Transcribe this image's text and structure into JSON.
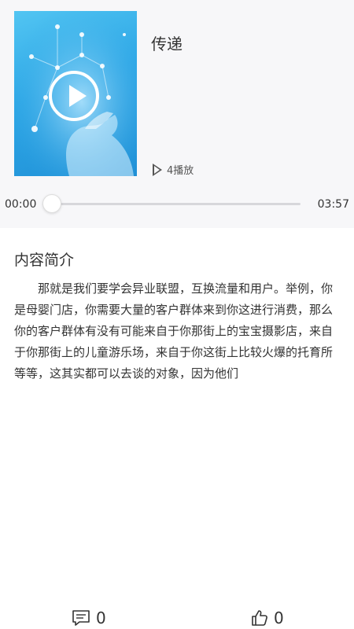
{
  "audio": {
    "title": "传递",
    "play_count_label": "4播放",
    "current_time": "00:00",
    "duration": "03:57",
    "progress_fraction": 0
  },
  "intro": {
    "heading": "内容简介",
    "body": "那就是我们要学会异业联盟，互换流量和用户。举例，你是母婴门店，你需要大量的客户群体来到你这进行消费，那么你的客户群体有没有可能来自于你那街上的宝宝摄影店，来自于你那街上的儿童游乐场，来自于你这街上比较火爆的托育所等等，这其实都可以去谈的对象，因为他们"
  },
  "actions": {
    "comment_count": "0",
    "like_count": "0"
  },
  "icons": {
    "cover_play": "play-circle-icon",
    "play_count": "play-outline-icon",
    "comment": "comment-icon",
    "like": "thumbs-up-icon"
  },
  "colors": {
    "accent": "#2ea7e6",
    "header_bg": "#f7f7f9",
    "text": "#333333"
  }
}
